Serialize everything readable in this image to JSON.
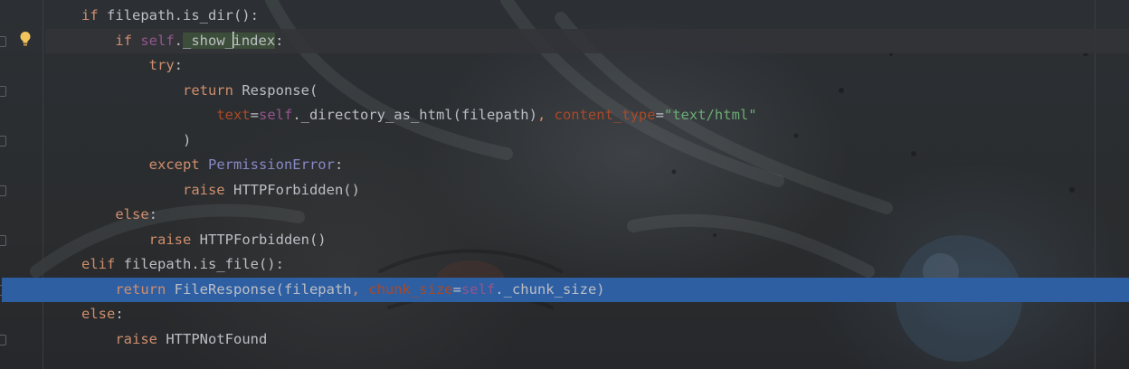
{
  "editor": {
    "lines": [
      {
        "indent": 0,
        "tokens": [
          {
            "t": "kw",
            "v": "if "
          },
          {
            "t": "fn",
            "v": "filepath.is_dir():"
          }
        ]
      },
      {
        "indent": 1,
        "tokens": [
          {
            "t": "kw",
            "v": "if "
          },
          {
            "t": "self",
            "v": "self"
          },
          {
            "t": "fn",
            "v": "."
          },
          {
            "t": "hl",
            "v": "_show_"
          },
          {
            "t": "caret",
            "v": ""
          },
          {
            "t": "hl",
            "v": "index"
          },
          {
            "t": "fn",
            "v": ":"
          }
        ]
      },
      {
        "indent": 2,
        "tokens": [
          {
            "t": "kw",
            "v": "try"
          },
          {
            "t": "fn",
            "v": ":"
          }
        ]
      },
      {
        "indent": 3,
        "tokens": [
          {
            "t": "kw",
            "v": "return "
          },
          {
            "t": "fn",
            "v": "Response("
          }
        ]
      },
      {
        "indent": 4,
        "tokens": [
          {
            "t": "param",
            "v": "text"
          },
          {
            "t": "fn",
            "v": "="
          },
          {
            "t": "self",
            "v": "self"
          },
          {
            "t": "fn",
            "v": "._directory_as_html(filepath)"
          },
          {
            "t": "kw",
            "v": ", "
          },
          {
            "t": "param",
            "v": "content_type"
          },
          {
            "t": "fn",
            "v": "="
          },
          {
            "t": "str",
            "v": "\"text/html\""
          }
        ]
      },
      {
        "indent": 3,
        "tokens": [
          {
            "t": "fn",
            "v": ")"
          }
        ]
      },
      {
        "indent": 2,
        "tokens": [
          {
            "t": "kw",
            "v": "except "
          },
          {
            "t": "cls",
            "v": "PermissionError"
          },
          {
            "t": "fn",
            "v": ":"
          }
        ]
      },
      {
        "indent": 3,
        "tokens": [
          {
            "t": "kw",
            "v": "raise "
          },
          {
            "t": "fn",
            "v": "HTTPForbidden()"
          }
        ]
      },
      {
        "indent": 1,
        "tokens": [
          {
            "t": "kw",
            "v": "else"
          },
          {
            "t": "fn",
            "v": ":"
          }
        ]
      },
      {
        "indent": 2,
        "tokens": [
          {
            "t": "kw",
            "v": "raise "
          },
          {
            "t": "fn",
            "v": "HTTPForbidden()"
          }
        ]
      },
      {
        "indent": 0,
        "tokens": [
          {
            "t": "kw",
            "v": "elif "
          },
          {
            "t": "fn",
            "v": "filepath.is_file():"
          }
        ]
      },
      {
        "indent": 1,
        "selected": true,
        "tokens": [
          {
            "t": "kw",
            "v": "return "
          },
          {
            "t": "fn",
            "v": "FileResponse(filepath"
          },
          {
            "t": "kw",
            "v": ", "
          },
          {
            "t": "param",
            "v": "chunk_size"
          },
          {
            "t": "fn",
            "v": "="
          },
          {
            "t": "self",
            "v": "self"
          },
          {
            "t": "fn",
            "v": "._chunk_size)"
          }
        ]
      },
      {
        "indent": 0,
        "tokens": [
          {
            "t": "kw",
            "v": "else"
          },
          {
            "t": "fn",
            "v": ":"
          }
        ]
      },
      {
        "indent": 1,
        "tokens": [
          {
            "t": "kw",
            "v": "raise "
          },
          {
            "t": "fn",
            "v": "HTTPNotFound"
          }
        ]
      }
    ],
    "caret_line": 1,
    "colors": {
      "keyword": "#cf8e6d",
      "self": "#94558d",
      "class": "#8888c6",
      "param": "#aa4926",
      "string": "#6aab73",
      "selection": "#2e5fa3"
    },
    "gutter": {
      "intention_icon": "lightbulb-icon"
    }
  }
}
